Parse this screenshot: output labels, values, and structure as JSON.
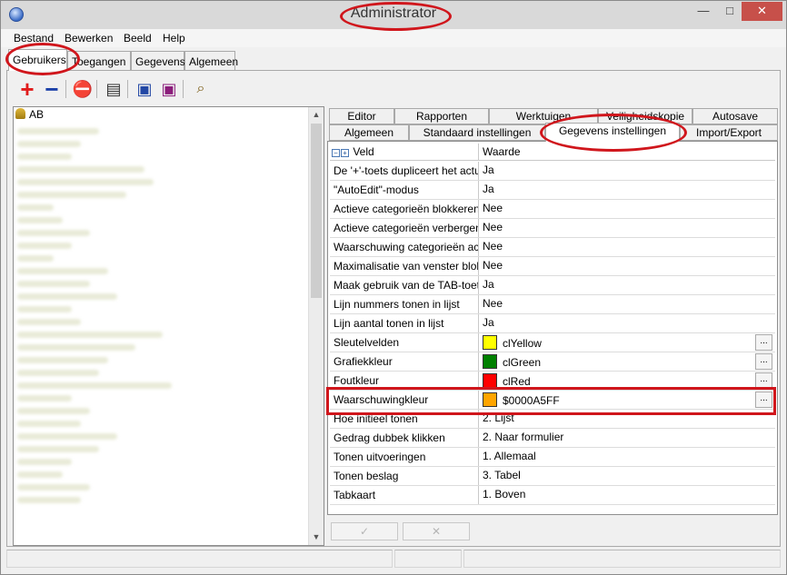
{
  "window": {
    "title": "Administrator",
    "min_glyph": "—",
    "max_glyph": "□",
    "close_glyph": "✕"
  },
  "menu": [
    "Bestand",
    "Bewerken",
    "Beeld",
    "Help"
  ],
  "tabs": [
    "Gebruikers",
    "Toegangen",
    "Gegevens",
    "Algemeen"
  ],
  "toolbar": {
    "add": "+",
    "remove": "−",
    "stop": "⛔",
    "card": "▤",
    "save1": "▣",
    "save2": "▣",
    "search": "⌕"
  },
  "tree": {
    "root": "AB"
  },
  "subtabs_row1": [
    "Editor",
    "Rapporten",
    "Werktuigen",
    "Veiligheidskopie",
    "Autosave"
  ],
  "subtabs_row2": [
    "Algemeen",
    "Standaard instellingen",
    "Gegevens instellingen",
    "Import/Export"
  ],
  "grid": {
    "header": {
      "field": "Veld",
      "value": "Waarde",
      "collapse": "−",
      "expand": "+"
    },
    "rows": [
      {
        "field": "De '+'-toets dupliceert het actuele",
        "value": "Ja"
      },
      {
        "field": "\"AutoEdit\"-modus",
        "value": "Ja"
      },
      {
        "field": "Actieve categorieën blokkeren",
        "value": "Nee"
      },
      {
        "field": "Actieve categorieën verbergen",
        "value": "Nee"
      },
      {
        "field": "Waarschuwing categorieën actief",
        "value": "Nee"
      },
      {
        "field": "Maximalisatie van venster blokker",
        "value": "Nee"
      },
      {
        "field": "Maak gebruik van de TAB-toets ir",
        "value": "Ja"
      },
      {
        "field": "Lijn nummers tonen in lijst",
        "value": "Nee"
      },
      {
        "field": "Lijn aantal tonen in lijst",
        "value": "Ja"
      },
      {
        "field": "Sleutelvelden",
        "value": "clYellow",
        "color": "#ffff00",
        "button": "..."
      },
      {
        "field": "Grafiekkleur",
        "value": "clGreen",
        "color": "#008000",
        "button": "..."
      },
      {
        "field": "Foutkleur",
        "value": "clRed",
        "color": "#ff0000",
        "button": "..."
      },
      {
        "field": "Waarschuwingkleur",
        "value": "$0000A5FF",
        "color": "#ffa500",
        "button": "..."
      },
      {
        "field": "Hoe initieel tonen",
        "value": "2. Lijst"
      },
      {
        "field": "Gedrag dubbek klikken",
        "value": "2. Naar formulier"
      },
      {
        "field": "Tonen uitvoeringen",
        "value": "1. Allemaal"
      },
      {
        "field": "Tonen beslag",
        "value": "3. Tabel"
      },
      {
        "field": "Tabkaart",
        "value": "1. Boven"
      }
    ]
  },
  "bottom_buttons": [
    "✓",
    "✕"
  ],
  "scroll": {
    "up": "▲",
    "down": "▼"
  }
}
